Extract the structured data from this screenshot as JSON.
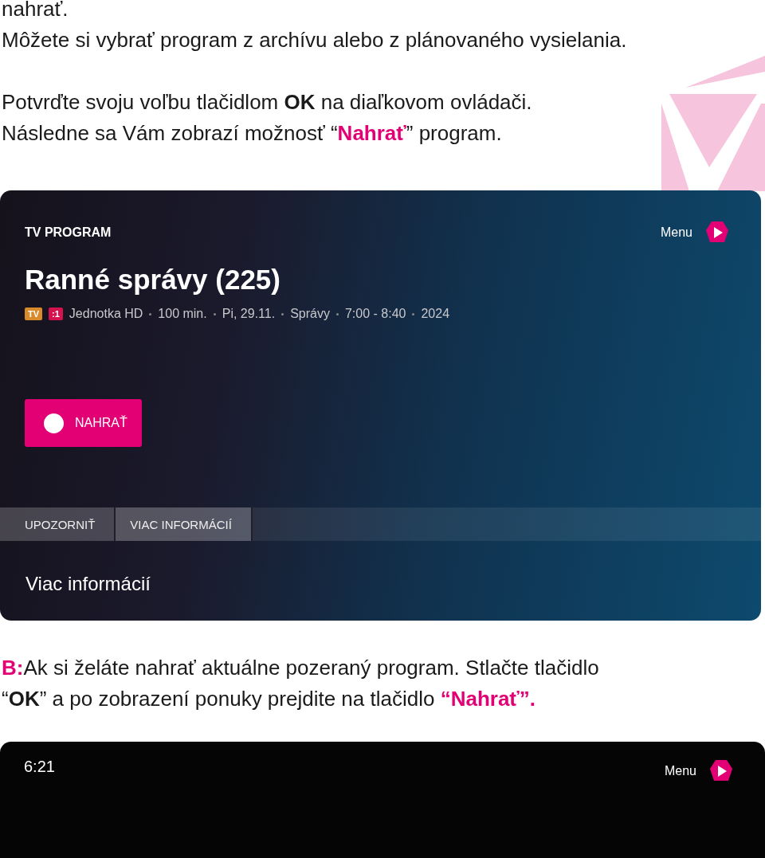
{
  "intro": [
    {
      "segments": [
        {
          "text": "nahrať.",
          "kind": "plain"
        }
      ]
    },
    {
      "segments": [
        {
          "text": "Môžete si vybrať program z archívu alebo z plánovaného vysielania.",
          "kind": "plain"
        }
      ]
    },
    {
      "segments": [
        {
          "text": "Potvrďte svoju voľbu tlačidlom ",
          "kind": "plain"
        },
        {
          "text": "OK",
          "kind": "bold"
        },
        {
          "text": " na diaľkovom ovládači.",
          "kind": "plain"
        }
      ]
    },
    {
      "segments": [
        {
          "text": "Následne sa Vám zobrazí možnosť “",
          "kind": "plain"
        },
        {
          "text": "Nahrať",
          "kind": "accent"
        },
        {
          "text": "” program.",
          "kind": "plain"
        }
      ]
    }
  ],
  "program_screen": {
    "label": "TV PROGRAM",
    "menu": "Menu",
    "title": "Ranné správy (225)",
    "badges": [
      {
        "text": "TV",
        "color": "#d98a2b"
      },
      {
        "text": ":1",
        "color": "#d4124e"
      }
    ],
    "meta": [
      "Jednotka HD",
      "100 min.",
      "Pi, 29.11.",
      "Správy",
      "7:00 - 8:40",
      "2024"
    ],
    "record_button": "NAHRAŤ",
    "tabs": [
      {
        "label": "UPOZORNIŤ",
        "selected": false
      },
      {
        "label": "VIAC INFORMÁCIÍ",
        "selected": true
      }
    ],
    "section_title": "Viac informácií"
  },
  "step_b": [
    {
      "segments": [
        {
          "text": "B:",
          "kind": "accent"
        },
        {
          "text": "Ak si želáte nahrať aktuálne pozeraný program. Stlačte tlačidlo",
          "kind": "plain"
        }
      ]
    },
    {
      "segments": [
        {
          "text": "“",
          "kind": "plain"
        },
        {
          "text": "OK",
          "kind": "bold"
        },
        {
          "text": "” a po zobrazení ponuky prejdite na tlačidlo ",
          "kind": "plain"
        },
        {
          "text": "“Nahrať”.",
          "kind": "accent"
        }
      ]
    }
  ],
  "live_screen": {
    "time": "6:21",
    "menu": "Menu"
  }
}
